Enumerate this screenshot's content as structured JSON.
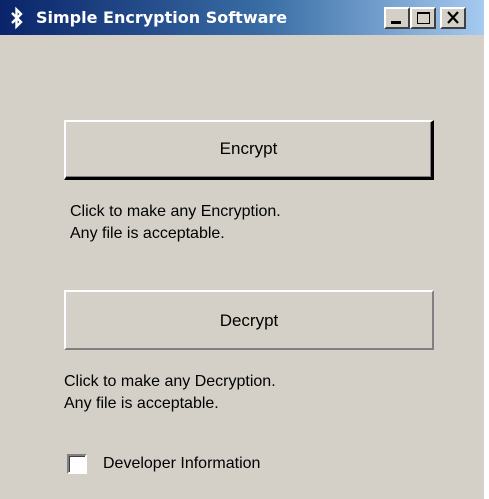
{
  "window": {
    "title": "Simple Encryption Software",
    "icon": "bluetooth-icon",
    "controls": {
      "minimize": "minimize-icon",
      "maximize": "maximize-icon",
      "close": "close-icon"
    }
  },
  "encrypt": {
    "button_label": "Encrypt",
    "description_line1": "Click to make any Encryption.",
    "description_line2": "Any file is acceptable."
  },
  "decrypt": {
    "button_label": "Decrypt",
    "description_line1": "Click to make any Decryption.",
    "description_line2": "Any file is acceptable."
  },
  "developer_info": {
    "label": "Developer Information",
    "checked": false
  },
  "colors": {
    "titlebar_start": "#0a246a",
    "titlebar_end": "#a6caf0",
    "window_background": "#d4d0c8"
  }
}
